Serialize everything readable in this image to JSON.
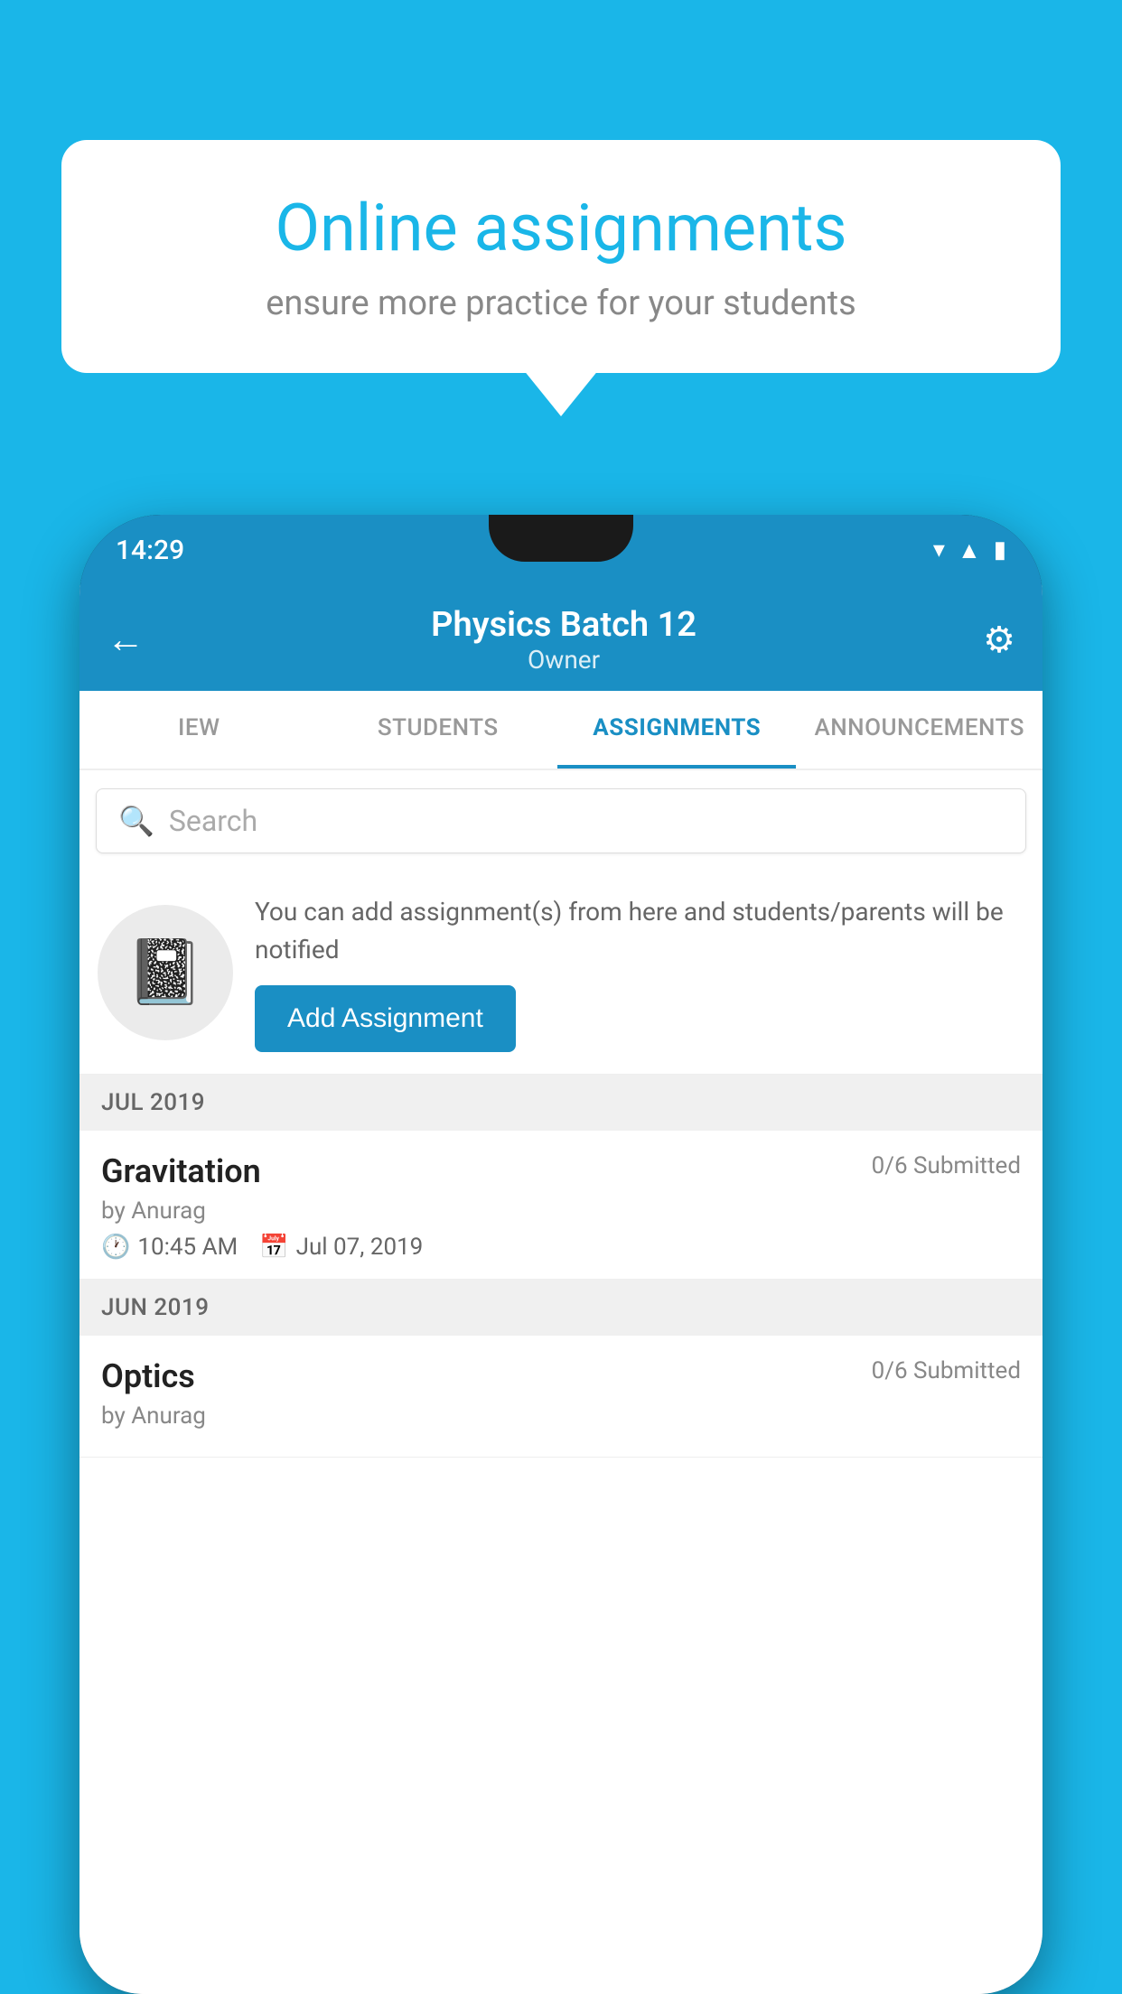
{
  "background_color": "#1ab6e8",
  "speech_bubble": {
    "title": "Online assignments",
    "subtitle": "ensure more practice for your students"
  },
  "status_bar": {
    "time": "14:29",
    "icons": [
      "wifi",
      "signal",
      "battery"
    ]
  },
  "app_header": {
    "back_label": "←",
    "title": "Physics Batch 12",
    "subtitle": "Owner",
    "settings_label": "⚙"
  },
  "tabs": [
    {
      "label": "IEW",
      "active": false
    },
    {
      "label": "STUDENTS",
      "active": false
    },
    {
      "label": "ASSIGNMENTS",
      "active": true
    },
    {
      "label": "ANNOUNCEMENTS",
      "active": false
    }
  ],
  "search": {
    "placeholder": "Search"
  },
  "promo": {
    "description": "You can add assignment(s) from here and students/parents will be notified",
    "button_label": "Add Assignment"
  },
  "sections": [
    {
      "header": "JUL 2019",
      "assignments": [
        {
          "name": "Gravitation",
          "status": "0/6 Submitted",
          "by": "by Anurag",
          "time": "10:45 AM",
          "date": "Jul 07, 2019"
        }
      ]
    },
    {
      "header": "JUN 2019",
      "assignments": [
        {
          "name": "Optics",
          "status": "0/6 Submitted",
          "by": "by Anurag",
          "time": "",
          "date": ""
        }
      ]
    }
  ]
}
